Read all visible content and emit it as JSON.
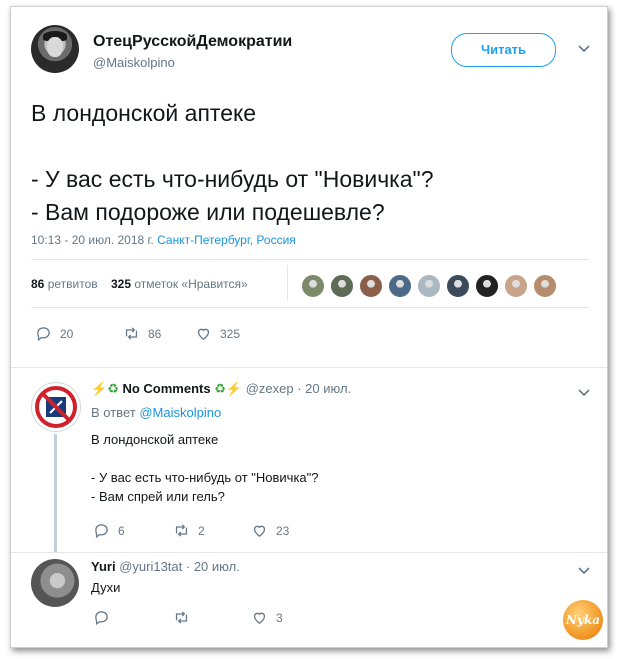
{
  "main_tweet": {
    "display_name": "ОтецРусскойДемократии",
    "handle": "@Maiskolpino",
    "follow_label": "Читать",
    "text": "В лондонской аптеке\n\n- У вас есть что-нибудь от \"Новичка\"?\n- Вам подороже или подешевле?",
    "time_date": "10:13 - 20 июл. 2018 г.",
    "location": "Санкт-Петербург, Россия",
    "retweets_count": "86",
    "retweets_label": "ретвитов",
    "likes_count": "325",
    "likes_label": "отметок «Нравится»",
    "actions": {
      "replies": "20",
      "retweets": "86",
      "likes": "325"
    }
  },
  "replies": [
    {
      "display_name": "No Comments",
      "handle": "@zexep",
      "date": "· 20 июл.",
      "reply_to_prefix": "В ответ",
      "reply_to_handle": "@Maiskolpino",
      "text": "В лондонской аптеке\n\n- У вас есть что-нибудь от \"Новичка\"?\n- Вам спрей или гель?",
      "actions": {
        "replies": "6",
        "retweets": "2",
        "likes": "23"
      }
    },
    {
      "display_name": "Yuri",
      "handle": "@yuri13tat",
      "date": "· 20 июл.",
      "text": "Духи",
      "actions": {
        "replies": "",
        "retweets": "",
        "likes": "3"
      }
    }
  ],
  "liker_avatar_colors": [
    "#7d8a6a",
    "#5d6b57",
    "#8b5e4a",
    "#4b6a8a",
    "#aab8c2",
    "#3a4a5a",
    "#222222",
    "#c9a38a",
    "#b58d6e"
  ],
  "watermark": "Nyka",
  "colors": {
    "accent": "#1da1f2",
    "link": "#1b95e0",
    "muted": "#657786",
    "text": "#14171a"
  }
}
